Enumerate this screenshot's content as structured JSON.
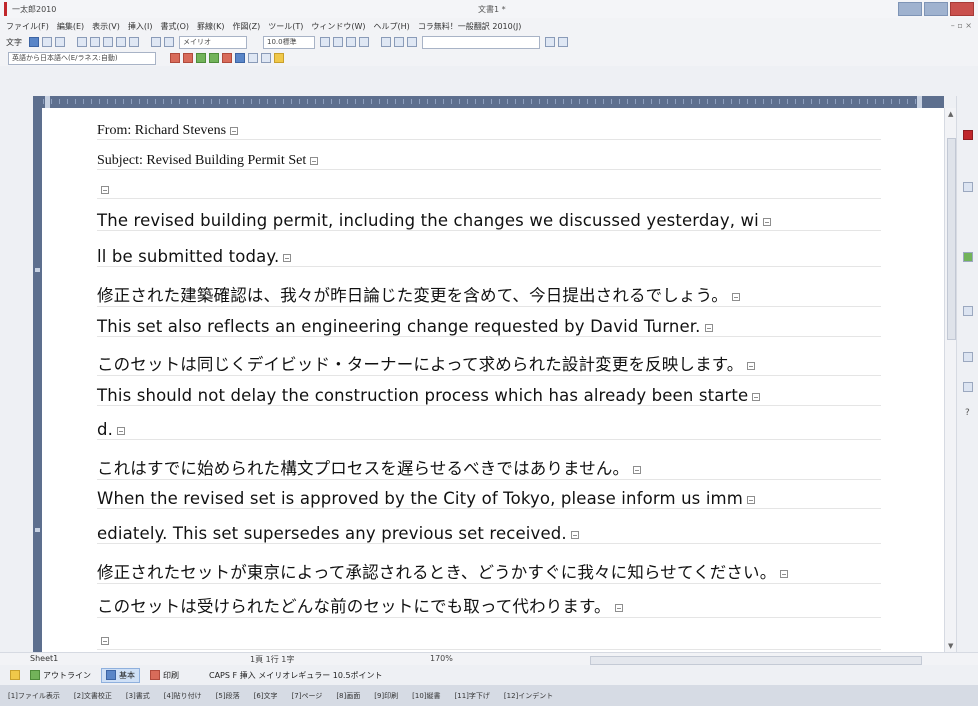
{
  "window": {
    "app_title": "一太郎2010",
    "document_title": "文書1 *"
  },
  "menu": [
    "ファイル(F)",
    "編集(E)",
    "表示(V)",
    "挿入(I)",
    "書式(O)",
    "罫線(K)",
    "作図(Z)",
    "ツール(T)",
    "ウィンドウ(W)",
    "ヘルプ(H)",
    "コラ無料！一般翻訳 2010(J)"
  ],
  "toolbar": {
    "mode_label": "文字",
    "font_name": "メイリオ",
    "font_size": "10.0標準",
    "translate_label": "英語から日本語へ(E/ラネス:自動)"
  },
  "document": {
    "lines": [
      {
        "text": "From: Richard Stevens",
        "style": "serif"
      },
      {
        "text": "Subject: Revised Building Permit Set",
        "style": "serif"
      },
      {
        "text": "",
        "style": "serif"
      },
      {
        "text": "The revised building permit, including the changes we discussed yesterday, wi",
        "style": "sans"
      },
      {
        "text": "ll be submitted today.",
        "style": "sans"
      },
      {
        "text": "修正された建築確認は、我々が昨日論じた変更を含めて、今日提出されるでしょう。",
        "style": "sans"
      },
      {
        "text": "This set also reflects an engineering change requested by David Turner.",
        "style": "sans"
      },
      {
        "text": "このセットは同じくデイビッド・ターナーによって求められた設計変更を反映します。",
        "style": "sans"
      },
      {
        "text": "This should not delay the construction process which has already been starte",
        "style": "sans"
      },
      {
        "text": "d.",
        "style": "sans"
      },
      {
        "text": "これはすでに始められた構文プロセスを遅らせるべきではありません。",
        "style": "sans"
      },
      {
        "text": "When the revised set is approved by the City of Tokyo, please inform us imm",
        "style": "sans"
      },
      {
        "text": "ediately. This set supersedes any previous set received.",
        "style": "sans"
      },
      {
        "text": "修正されたセットが東京によって承認されるとき、どうかすぐに我々に知らせてください。",
        "style": "sans"
      },
      {
        "text": " このセットは受けられたどんな前のセットにでも取って代わります。",
        "style": "sans"
      },
      {
        "text": "",
        "style": "sans"
      },
      {
        "text": "",
        "style": "sans"
      }
    ]
  },
  "bottom": {
    "sheet_tab": "Sheet1",
    "mid_info": "1頁  1行  1字",
    "zoom": "170%",
    "views": [
      "アウトライン",
      "基本",
      "印刷"
    ],
    "caps_info": "CAPS  F  挿入  メイリオレギュラー 10.5ポイント"
  },
  "status": [
    "[1]ファイル表示",
    "[2]文書校正",
    "[3]書式",
    "[4]貼り付け",
    "[5]段落",
    "[6]文字",
    "[7]ページ",
    "[8]画面",
    "[9]印刷",
    "[10]縦書",
    "[11]字下げ",
    "[12]インデント"
  ]
}
